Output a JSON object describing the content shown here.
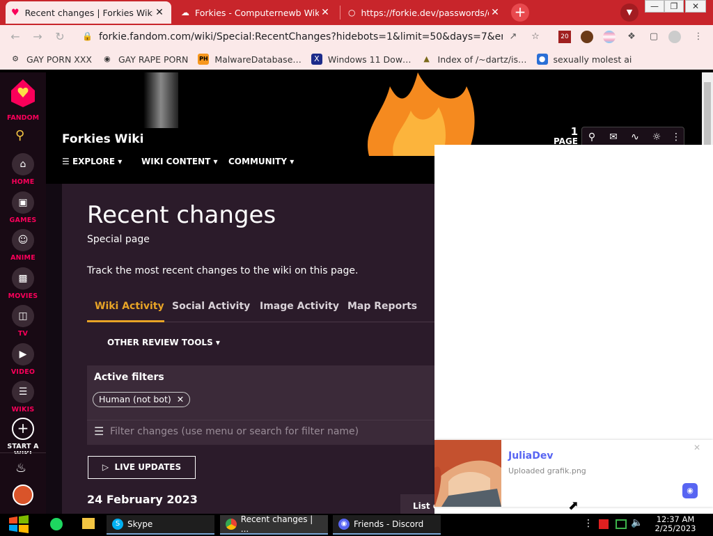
{
  "browser": {
    "tabs": [
      {
        "title": "Recent changes | Forkies Wiki",
        "active": true,
        "icon": "fandom-icon"
      },
      {
        "title": "Forkies - Computernewb Wiki",
        "active": false,
        "icon": "computernewb-icon"
      },
      {
        "title": "https://forkie.dev/passwords/d",
        "active": false,
        "icon": "globe-icon"
      }
    ],
    "new_tab": "+",
    "url": "forkie.fandom.com/wiki/Special:RecentChanges?hidebots=1&limit=50&days=7&enhance…",
    "extension_badge": "20",
    "bookmarks": [
      {
        "label": "GAY PORN XXX",
        "icon": "gear-icon"
      },
      {
        "label": "GAY RAPE PORN",
        "icon": "circle-icon"
      },
      {
        "label": "MalwareDatabase…",
        "icon": "ph-icon"
      },
      {
        "label": "Windows 11 Dow…",
        "icon": "x-icon"
      },
      {
        "label": "Index of /~dartz/is…",
        "icon": "folder-icon"
      },
      {
        "label": "sexually molest ai",
        "icon": "ai-icon"
      }
    ]
  },
  "rail": {
    "logo_label": "FANDOM",
    "items": [
      {
        "label": "HOME",
        "icon": "home-icon"
      },
      {
        "label": "GAMES",
        "icon": "gamepad-icon"
      },
      {
        "label": "ANIME",
        "icon": "anime-icon"
      },
      {
        "label": "MOVIES",
        "icon": "movies-icon"
      },
      {
        "label": "TV",
        "icon": "tv-icon"
      },
      {
        "label": "VIDEO",
        "icon": "video-icon"
      },
      {
        "label": "WIKIS",
        "icon": "book-icon"
      },
      {
        "label": "START A WIKI",
        "icon": "plus-icon"
      }
    ]
  },
  "wiki": {
    "title": "Forkies Wiki",
    "nav": [
      "EXPLORE",
      "WIKI CONTENT",
      "COMMUNITY"
    ],
    "page_count": "1",
    "page_label": "PAGE"
  },
  "content": {
    "heading": "Recent changes",
    "subheading": "Special page",
    "description": "Track the most recent changes to the wiki on this page.",
    "tabs": [
      "Wiki Activity",
      "Social Activity",
      "Image Activity",
      "Map Reports"
    ],
    "review_tools": "OTHER REVIEW TOOLS",
    "active_filters_label": "Active filters",
    "filter_chip": "Human (not bot)",
    "filter_placeholder": "Filter changes (use menu or search for filter name)",
    "live_updates": "LIVE UPDATES",
    "date": "24 February 2023",
    "list_button": "List o"
  },
  "notification": {
    "name": "JuliaDev",
    "message": "Uploaded grafik.png"
  },
  "taskbar": {
    "items": [
      {
        "label": "Skype",
        "icon": "skype-icon"
      },
      {
        "label": "Recent changes | ...",
        "icon": "chrome-icon"
      },
      {
        "label": "Friends - Discord",
        "icon": "discord-icon"
      }
    ],
    "time": "12:37 AM",
    "date": "2/25/2023"
  },
  "colors": {
    "fandom_pink": "#fa005a",
    "tab_accent": "#e8a426",
    "chrome_red": "#c8252b",
    "discord_blurple": "#5865f2"
  }
}
